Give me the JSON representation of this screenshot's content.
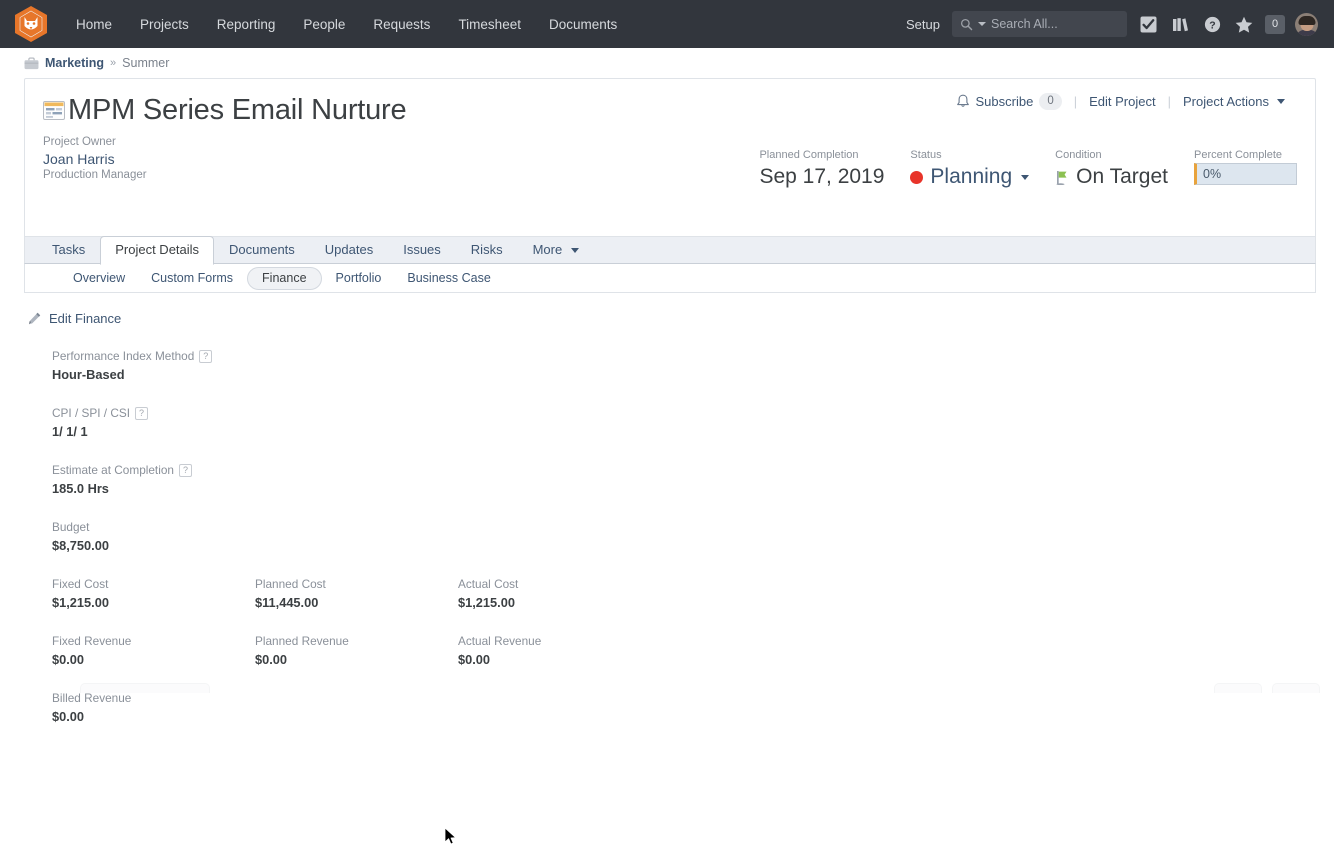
{
  "topnav": {
    "logo_name": "workfront-lion-logo",
    "links": [
      {
        "label": "Home",
        "name": "nav-home"
      },
      {
        "label": "Projects",
        "name": "nav-projects"
      },
      {
        "label": "Reporting",
        "name": "nav-reporting"
      },
      {
        "label": "People",
        "name": "nav-people"
      },
      {
        "label": "Requests",
        "name": "nav-requests"
      },
      {
        "label": "Timesheet",
        "name": "nav-timesheet"
      },
      {
        "label": "Documents",
        "name": "nav-documents"
      }
    ],
    "setup_label": "Setup",
    "search_placeholder": "Search All...",
    "notification_count": "0",
    "colors": {
      "bar_bg": "#32363d",
      "search_bg": "#42464e",
      "link": "#d6d9dd",
      "logo_orange": "#e7762a"
    }
  },
  "breadcrumb": {
    "primary": "Marketing",
    "separator": "»",
    "secondary": "Summer"
  },
  "project": {
    "title": "MPM Series Email Nurture",
    "owner_label": "Project Owner",
    "owner_name": "Joan Harris",
    "owner_role": "Production Manager",
    "actions": {
      "subscribe_label": "Subscribe",
      "subscribe_count": "0",
      "edit_project_label": "Edit Project",
      "project_actions_label": "Project Actions",
      "divider": "|"
    },
    "meta": [
      {
        "label": "Planned Completion",
        "value": "Sep 17, 2019",
        "name": "planned-completion"
      },
      {
        "label": "Status",
        "value": "Planning",
        "name": "status"
      },
      {
        "label": "Condition",
        "value": "On Target",
        "name": "condition"
      },
      {
        "label": "Percent Complete",
        "value": "0%",
        "name": "percent-complete"
      }
    ],
    "colors": {
      "status_dot": "#e8342a",
      "condition_flag": "#8cc152",
      "percent_accent": "#e8a33d",
      "percent_field_bg": "#dde6ef",
      "link": "#3e5673"
    }
  },
  "tabs": [
    {
      "label": "Tasks",
      "name": "tab-tasks",
      "active": false
    },
    {
      "label": "Project Details",
      "name": "tab-project-details",
      "active": true
    },
    {
      "label": "Documents",
      "name": "tab-documents",
      "active": false
    },
    {
      "label": "Updates",
      "name": "tab-updates",
      "active": false
    },
    {
      "label": "Issues",
      "name": "tab-issues",
      "active": false
    },
    {
      "label": "Risks",
      "name": "tab-risks",
      "active": false
    },
    {
      "label": "More",
      "name": "tab-more",
      "active": false,
      "has_caret": true
    }
  ],
  "subtabs": [
    {
      "label": "Overview",
      "name": "subtab-overview",
      "active": false
    },
    {
      "label": "Custom Forms",
      "name": "subtab-custom-forms",
      "active": false
    },
    {
      "label": "Finance",
      "name": "subtab-finance",
      "active": true
    },
    {
      "label": "Portfolio",
      "name": "subtab-portfolio",
      "active": false
    },
    {
      "label": "Business Case",
      "name": "subtab-business-case",
      "active": false
    }
  ],
  "finance": {
    "edit_link": "Edit Finance",
    "rows": [
      [
        {
          "label": "Performance Index Method",
          "value": "Hour-Based",
          "help": "?",
          "name": "performance-index-method"
        }
      ],
      [
        {
          "label": "CPI / SPI / CSI",
          "value": "1/  1/  1",
          "help": "?",
          "name": "cpi-spi-csi"
        }
      ],
      [
        {
          "label": "Estimate at Completion",
          "value": "185.0 Hrs",
          "help": "?",
          "name": "estimate-at-completion"
        }
      ],
      [
        {
          "label": "Budget",
          "value": "$8,750.00",
          "name": "budget"
        }
      ],
      [
        {
          "label": "Fixed Cost",
          "value": "$1,215.00",
          "name": "fixed-cost"
        },
        {
          "label": "Planned Cost",
          "value": "$11,445.00",
          "name": "planned-cost"
        },
        {
          "label": "Actual Cost",
          "value": "$1,215.00",
          "name": "actual-cost"
        }
      ],
      [
        {
          "label": "Fixed Revenue",
          "value": "$0.00",
          "name": "fixed-revenue"
        },
        {
          "label": "Planned Revenue",
          "value": "$0.00",
          "name": "planned-revenue"
        },
        {
          "label": "Actual Revenue",
          "value": "$0.00",
          "name": "actual-revenue"
        }
      ],
      [
        {
          "label": "Billed Revenue",
          "value": "$0.00",
          "name": "billed-revenue"
        }
      ]
    ]
  }
}
